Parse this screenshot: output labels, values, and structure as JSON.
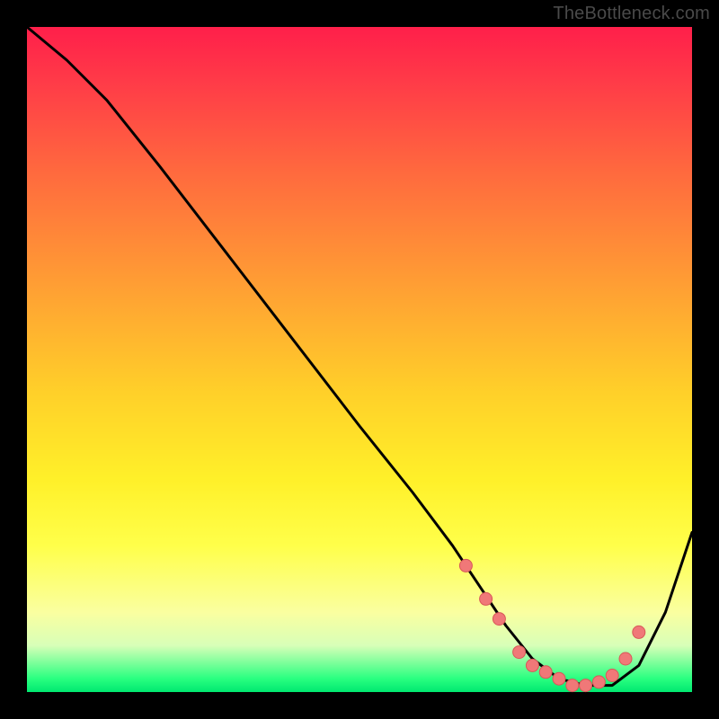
{
  "watermark": "TheBottleneck.com",
  "colors": {
    "curve": "#000000",
    "marker_fill": "#f07878",
    "marker_stroke": "#d85858"
  },
  "chart_data": {
    "type": "line",
    "title": "",
    "xlabel": "",
    "ylabel": "",
    "xlim": [
      0,
      100
    ],
    "ylim": [
      0,
      100
    ],
    "grid": false,
    "series": [
      {
        "name": "bottleneck-curve",
        "x": [
          0,
          6,
          12,
          20,
          30,
          40,
          50,
          58,
          64,
          68,
          72,
          76,
          80,
          84,
          88,
          92,
          96,
          100
        ],
        "y": [
          100,
          95,
          89,
          79,
          66,
          53,
          40,
          30,
          22,
          16,
          10,
          5,
          2,
          1,
          1,
          4,
          12,
          24
        ]
      }
    ],
    "markers": {
      "name": "highlighted-points",
      "x": [
        66,
        69,
        71,
        74,
        76,
        78,
        80,
        82,
        84,
        86,
        88,
        90,
        92
      ],
      "y": [
        19,
        14,
        11,
        6,
        4,
        3,
        2,
        1,
        1,
        1.5,
        2.5,
        5,
        9
      ]
    }
  }
}
